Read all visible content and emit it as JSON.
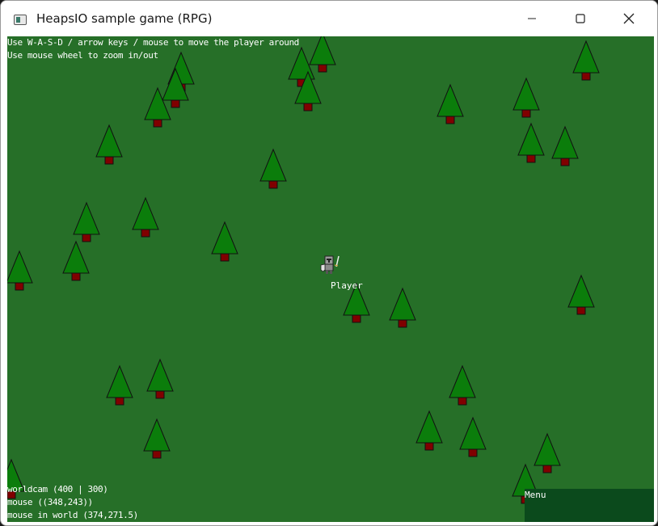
{
  "window": {
    "title": "HeapsIO sample game (RPG)"
  },
  "controls": {
    "minimize_icon": "minimize-icon",
    "maximize_icon": "maximize-icon",
    "close_icon": "close-icon"
  },
  "colors": {
    "grass": "#266f28",
    "tree_canopy": "#0b7d0b",
    "tree_trunk": "#800000",
    "menu_panel": "#0b4a1c",
    "hud_text": "#ffffff"
  },
  "hud": {
    "help_lines": [
      "Use W-A-S-D / arrow keys / mouse to move the player around",
      "Use mouse wheel to zoom in/out"
    ],
    "debug_lines": [
      "worldcam (400 | 300)",
      "mouse ((348,243))",
      "mouse in world (374,271.5)"
    ]
  },
  "player": {
    "label": "Player"
  },
  "menu": {
    "label": "Menu"
  }
}
